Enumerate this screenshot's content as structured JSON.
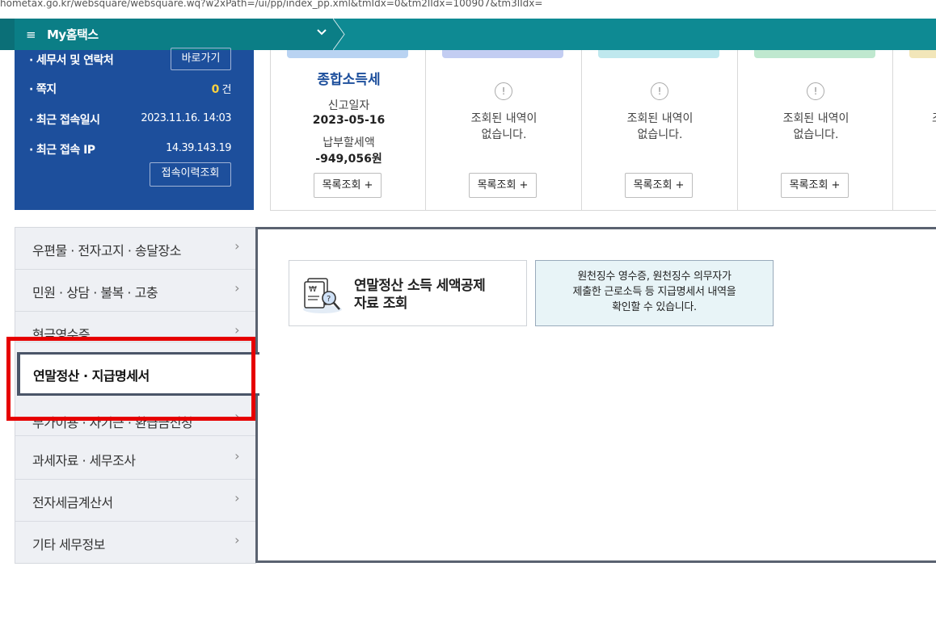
{
  "url": "hometax.go.kr/websquare/websquare.wq?w2xPath=/ui/pp/index_pp.xml&tmIdx=0&tm2lIdx=100907&tm3lIdx=",
  "topnav": {
    "menu_icon": "hamburger-icon",
    "title": "My홈택스",
    "chevron_icon": "chevron-down-icon"
  },
  "user": {
    "tax_office_label": "세무서 및 연락처",
    "tax_office_button": "바로가기",
    "memo_label": "쪽지",
    "memo_count": "0",
    "memo_unit": "건",
    "last_login_label": "최근 접속일시",
    "last_login_value": "2023.11.16.  14:03",
    "last_ip_label": "최근 접속 IP",
    "last_ip_value": "14.39.143.19",
    "history_button": "접속이력조회"
  },
  "cards": [
    {
      "title": "종합소득세",
      "date_label": "신고일자",
      "date_value": "2023-05-16",
      "amount_label": "납부할세액",
      "amount_value": "-949,056원",
      "button": "목록조회 +",
      "cap_color": "#b9d3f2"
    },
    {
      "empty_line1": "조회된 내역이",
      "empty_line2": "없습니다.",
      "button": "목록조회 +",
      "cap_color": "#c3cdf2"
    },
    {
      "empty_line1": "조회된 내역이",
      "empty_line2": "없습니다.",
      "button": "목록조회 +",
      "cap_color": "#bfe8ee"
    },
    {
      "empty_line1": "조회된 내역이",
      "empty_line2": "없습니다.",
      "button": "목록조회 +",
      "cap_color": "#bfe8cf"
    },
    {
      "empty_line1": "조",
      "cap_color": "#f2e6b9"
    }
  ],
  "sidenav": {
    "items": [
      {
        "label": "우편물 · 전자고지 · 송달장소"
      },
      {
        "label": "민원 · 상담 · 불복 · 고충"
      },
      {
        "label": "현금영수증"
      },
      {
        "label": "연말정산 · 지급명세서"
      },
      {
        "label": "부가이용 · 자기근 · 환급금신청"
      },
      {
        "label": "과세자료 · 세무조사"
      },
      {
        "label": "전자세금계산서"
      },
      {
        "label": "기타 세무정보"
      }
    ]
  },
  "content": {
    "service_label_line1": "연말정산 소득 세액공제",
    "service_label_line2": "자료 조회",
    "desc_line1": "원천징수 영수증, 원천징수 의무자가",
    "desc_line2": "제출한 근로소득 등 지급명세서 내역을",
    "desc_line3": "확인할 수 있습니다."
  },
  "colors": {
    "nav": "#0e8a93",
    "userbox": "#1d4f9c",
    "highlight": "#e60000"
  }
}
